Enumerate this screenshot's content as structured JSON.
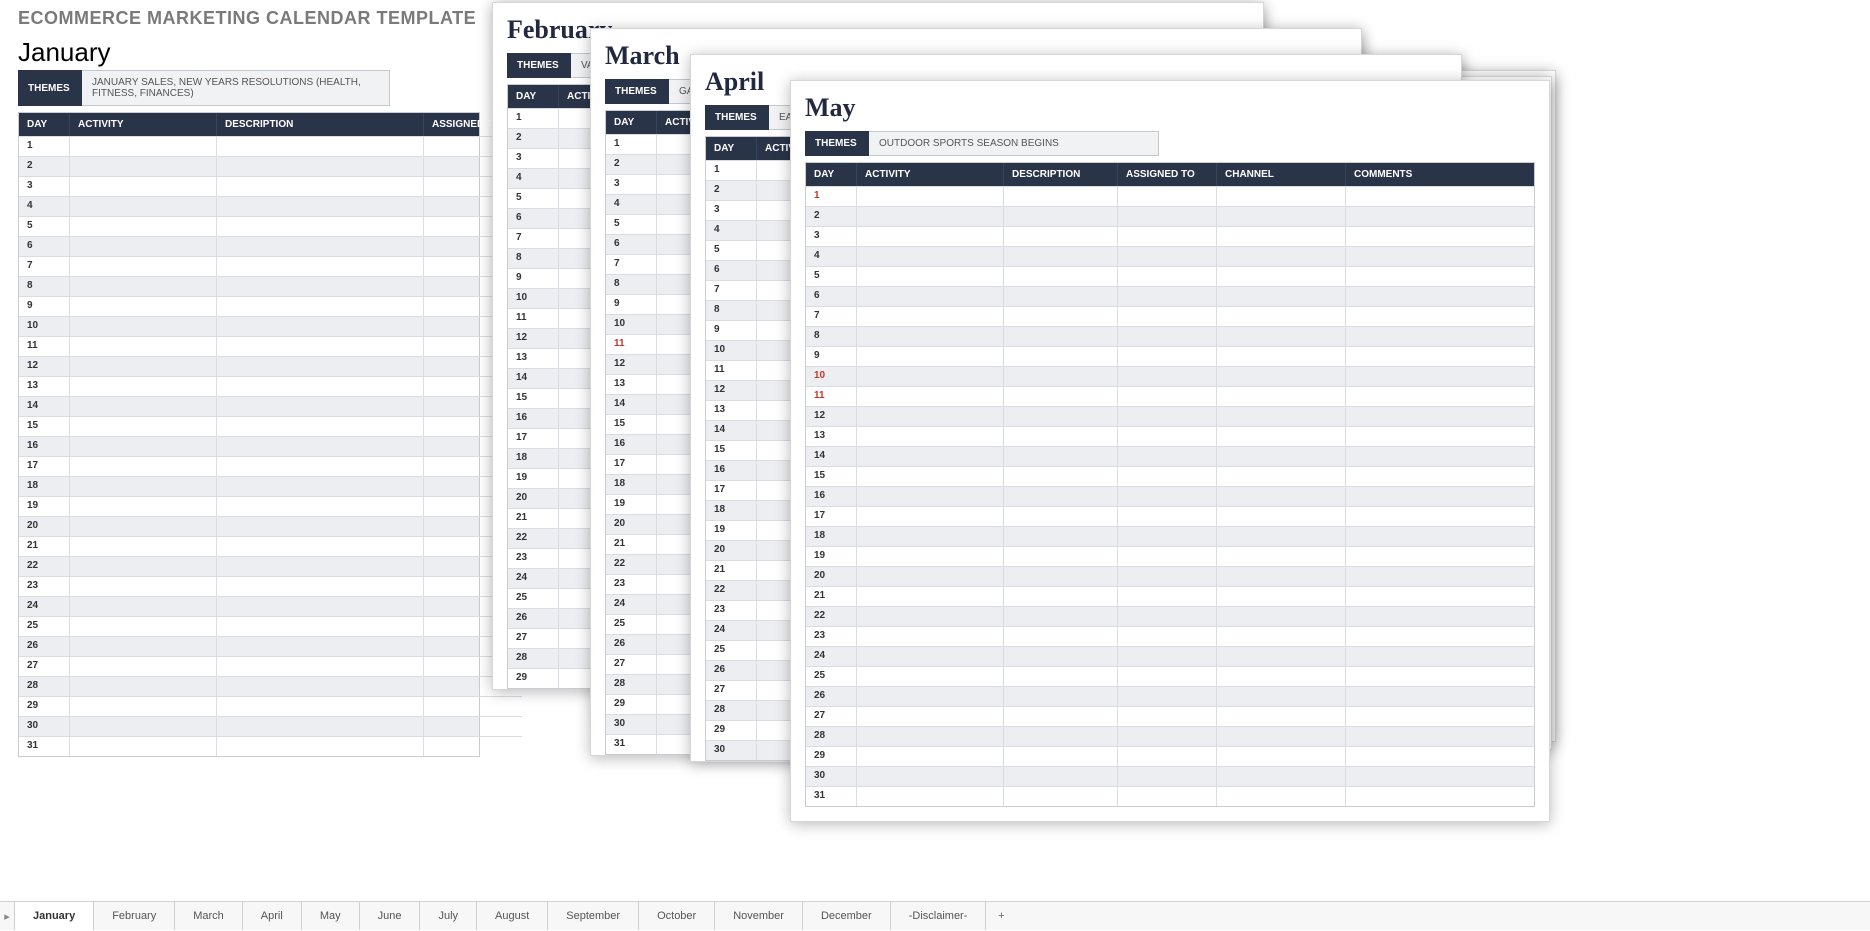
{
  "page_title": "ECOMMERCE MARKETING CALENDAR TEMPLATE",
  "themes_label": "THEMES",
  "columns": {
    "day": "DAY",
    "activity": "ACTIVITY",
    "description": "DESCRIPTION",
    "assigned": "ASSIGNED TO",
    "channel": "CHANNEL",
    "comments": "COMMENTS"
  },
  "sheets": {
    "january": {
      "title": "January",
      "themes": "JANUARY SALES, NEW YEARS RESOLUTIONS (HEALTH, FITNESS, FINANCES)",
      "days": 31,
      "red_days": []
    },
    "february": {
      "title": "February",
      "themes": "VALENTIN",
      "days": 29,
      "red_days": []
    },
    "march": {
      "title": "March",
      "themes": "GARDENIN",
      "days": 31,
      "red_days": [
        11
      ]
    },
    "april": {
      "title": "April",
      "themes": "EASTER, WE",
      "days": 30,
      "red_days": []
    },
    "may": {
      "title": "May",
      "themes": "OUTDOOR SPORTS SEASON BEGINS",
      "days": 31,
      "red_days": [
        1,
        10,
        11
      ]
    }
  },
  "tabs": [
    "January",
    "February",
    "March",
    "April",
    "May",
    "June",
    "July",
    "August",
    "September",
    "October",
    "November",
    "December",
    "-Disclaimer-"
  ],
  "active_tab": 0,
  "tab_plus": "+"
}
